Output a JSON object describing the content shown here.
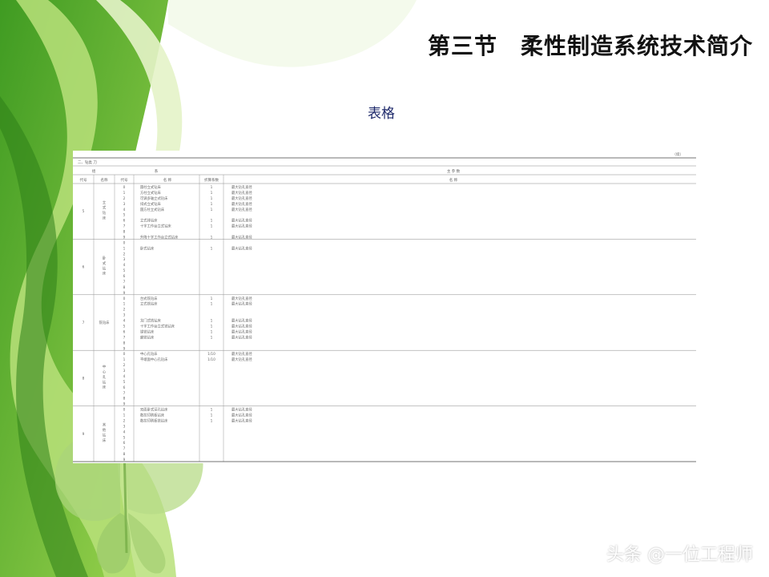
{
  "slide": {
    "title": "第三节　柔性制造系统技术简介",
    "subtitle": "表格",
    "watermark": "头条 @一位工程师"
  },
  "table": {
    "continued_mark": "（续）",
    "section_caption": "二、钻类 刀",
    "group_header_left": "组",
    "group_header_mid": "系",
    "group_header_right": "主 参 数",
    "columns": [
      "代号",
      "名称",
      "代号",
      "名  称",
      "折算系数",
      "名  称"
    ],
    "groups": [
      {
        "code": "5",
        "name": "立式钻床",
        "rows": [
          {
            "no": "0",
            "name": "圆柱立式钻床",
            "factor": "1",
            "param": "最大钻孔直径"
          },
          {
            "no": "1",
            "name": "方柱立式钻床",
            "factor": "1",
            "param": "最大钻孔直径"
          },
          {
            "no": "2",
            "name": "可调多轴立式钻床",
            "factor": "1",
            "param": "最大钻孔直径"
          },
          {
            "no": "3",
            "name": "排式立式钻床",
            "factor": "1",
            "param": "最大钻孔直径"
          },
          {
            "no": "4",
            "name": "圆方柱立式钻床",
            "factor": "1",
            "param": "最大钻孔直径"
          },
          {
            "no": "5",
            "name": "",
            "factor": "",
            "param": ""
          },
          {
            "no": "6",
            "name": "立式排钻床",
            "factor": "1",
            "param": "最大钻孔直径"
          },
          {
            "no": "7",
            "name": "十字工作台立式钻床",
            "factor": "1",
            "param": "最大钻孔直径"
          },
          {
            "no": "8",
            "name": "",
            "factor": "",
            "param": ""
          },
          {
            "no": "9",
            "name": "升降十字工作台立式钻床",
            "factor": "1",
            "param": "最大钻孔直径"
          }
        ]
      },
      {
        "code": "6",
        "name": "卧式钻床",
        "rows": [
          {
            "no": "0",
            "name": "",
            "factor": "",
            "param": ""
          },
          {
            "no": "1",
            "name": "卧式钻床",
            "factor": "1",
            "param": "最大钻孔直径"
          },
          {
            "no": "2",
            "name": "",
            "factor": "",
            "param": ""
          },
          {
            "no": "3",
            "name": "",
            "factor": "",
            "param": ""
          },
          {
            "no": "4",
            "name": "",
            "factor": "",
            "param": ""
          },
          {
            "no": "5",
            "name": "",
            "factor": "",
            "param": ""
          },
          {
            "no": "6",
            "name": "",
            "factor": "",
            "param": ""
          },
          {
            "no": "7",
            "name": "",
            "factor": "",
            "param": ""
          },
          {
            "no": "8",
            "name": "",
            "factor": "",
            "param": ""
          },
          {
            "no": "9",
            "name": "",
            "factor": "",
            "param": ""
          }
        ]
      },
      {
        "code": "7",
        "name": "铣钻床",
        "rows": [
          {
            "no": "0",
            "name": "台式铣钻床",
            "factor": "1",
            "param": "最大钻孔直径"
          },
          {
            "no": "1",
            "name": "立式铣钻床",
            "factor": "1",
            "param": "最大钻孔直径"
          },
          {
            "no": "2",
            "name": "",
            "factor": "",
            "param": ""
          },
          {
            "no": "3",
            "name": "",
            "factor": "",
            "param": ""
          },
          {
            "no": "4",
            "name": "龙门式铣钻床",
            "factor": "1",
            "param": "最大钻孔直径"
          },
          {
            "no": "5",
            "name": "十字工作台立式铣钻床",
            "factor": "1",
            "param": "最大钻孔直径"
          },
          {
            "no": "6",
            "name": "镗铣钻床",
            "factor": "1",
            "param": "最大钻孔直径"
          },
          {
            "no": "7",
            "name": "磨铣钻床",
            "factor": "1",
            "param": "最大钻孔直径"
          },
          {
            "no": "8",
            "name": "",
            "factor": "",
            "param": ""
          },
          {
            "no": "9",
            "name": "",
            "factor": "",
            "param": ""
          }
        ]
      },
      {
        "code": "8",
        "name": "中心孔钻床",
        "rows": [
          {
            "no": "0",
            "name": "中心孔钻床",
            "factor": "1/10",
            "param": "最大钻孔直径"
          },
          {
            "no": "1",
            "name": "平端面中心孔钻床",
            "factor": "1/10",
            "param": "最大钻孔直径"
          },
          {
            "no": "2",
            "name": "",
            "factor": "",
            "param": ""
          },
          {
            "no": "3",
            "name": "",
            "factor": "",
            "param": ""
          },
          {
            "no": "4",
            "name": "",
            "factor": "",
            "param": ""
          },
          {
            "no": "5",
            "name": "",
            "factor": "",
            "param": ""
          },
          {
            "no": "6",
            "name": "",
            "factor": "",
            "param": ""
          },
          {
            "no": "7",
            "name": "",
            "factor": "",
            "param": ""
          },
          {
            "no": "8",
            "name": "",
            "factor": "",
            "param": ""
          },
          {
            "no": "9",
            "name": "",
            "factor": "",
            "param": ""
          }
        ]
      },
      {
        "code": "9",
        "name": "其他钻床",
        "rows": [
          {
            "no": "0",
            "name": "双面卧式深孔钻床",
            "factor": "1",
            "param": "最大钻孔直径"
          },
          {
            "no": "1",
            "name": "数控印刷板钻床",
            "factor": "1",
            "param": "最大钻孔直径"
          },
          {
            "no": "2",
            "name": "数控印刷板铣钻床",
            "factor": "1",
            "param": "最大钻孔直径"
          },
          {
            "no": "3",
            "name": "",
            "factor": "",
            "param": ""
          },
          {
            "no": "4",
            "name": "",
            "factor": "",
            "param": ""
          },
          {
            "no": "5",
            "name": "",
            "factor": "",
            "param": ""
          },
          {
            "no": "6",
            "name": "",
            "factor": "",
            "param": ""
          },
          {
            "no": "7",
            "name": "",
            "factor": "",
            "param": ""
          },
          {
            "no": "8",
            "name": "",
            "factor": "",
            "param": ""
          },
          {
            "no": "9",
            "name": "",
            "factor": "",
            "param": ""
          }
        ]
      }
    ]
  }
}
